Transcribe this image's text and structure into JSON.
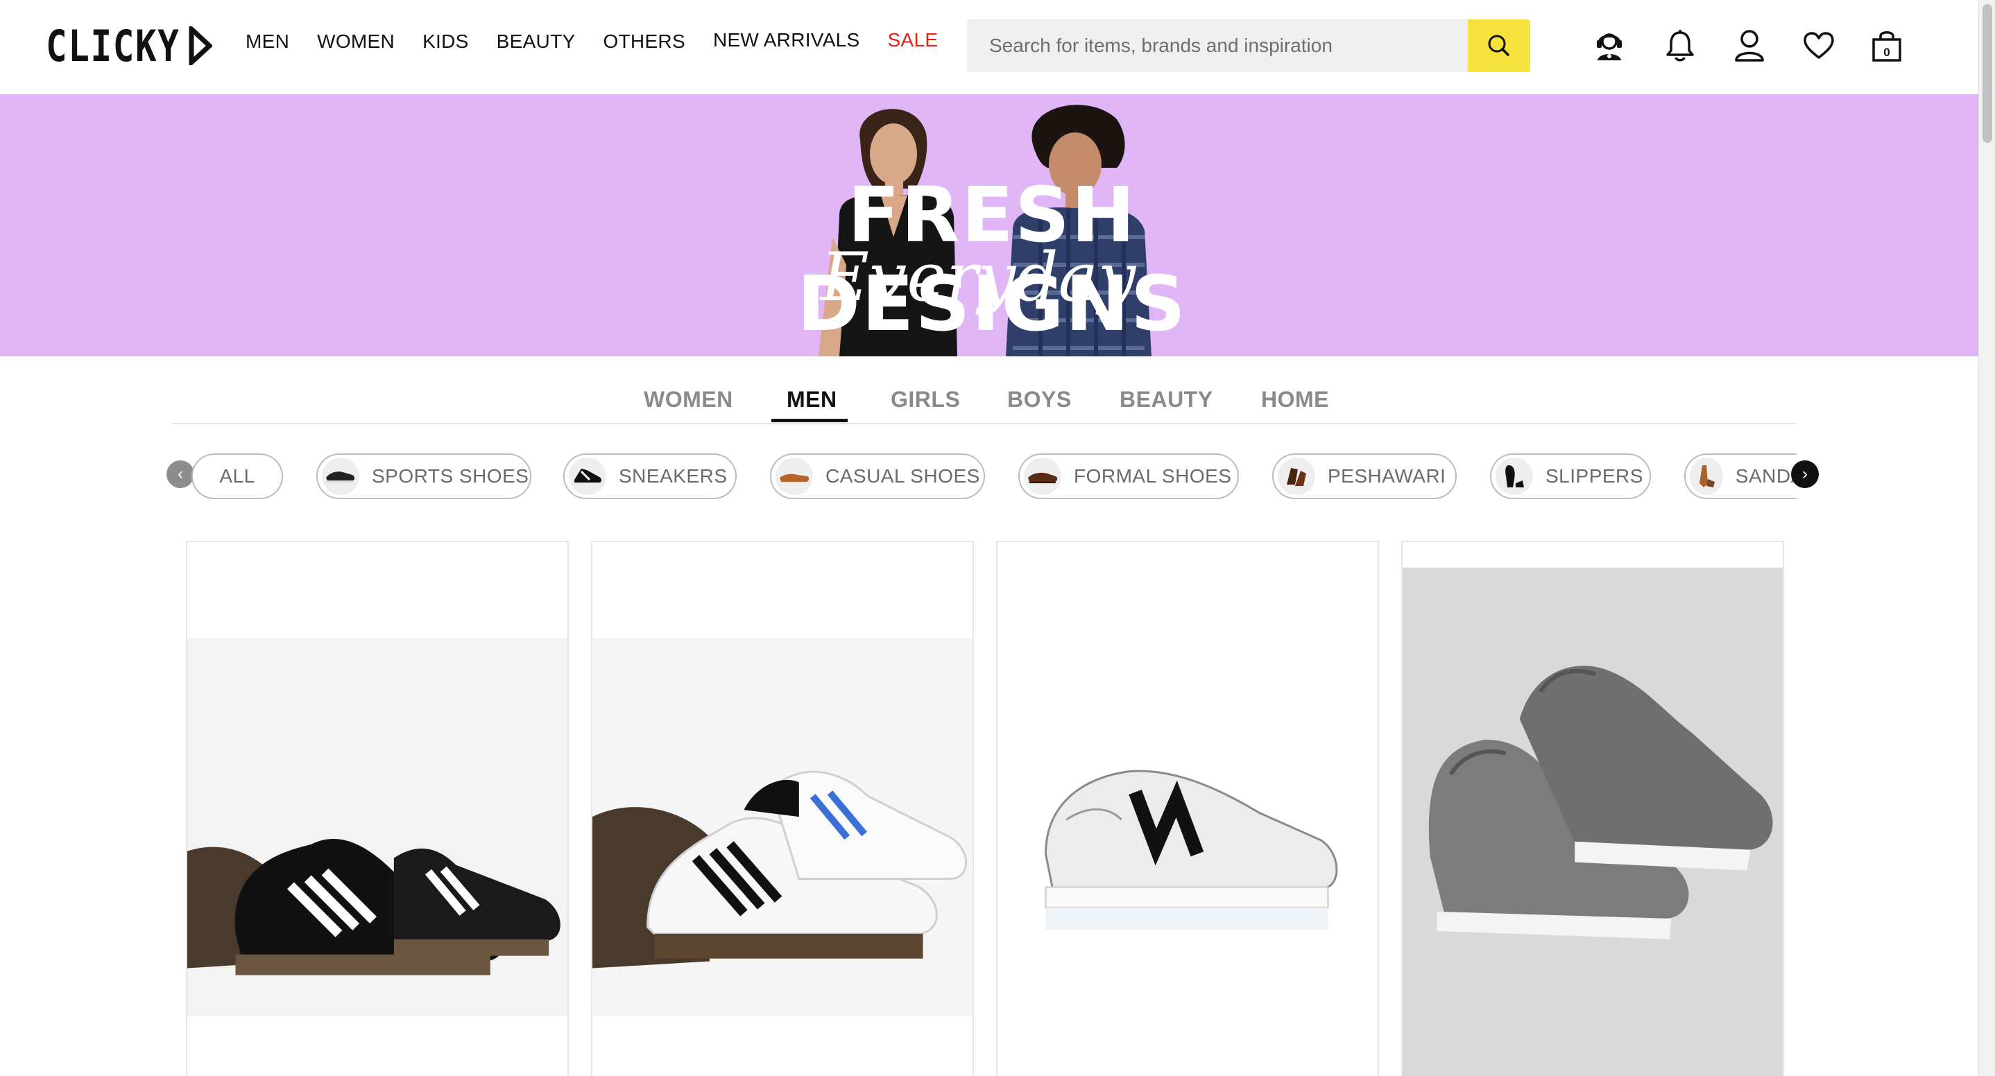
{
  "header": {
    "logo": "CLICKY",
    "nav": [
      {
        "label": "MEN"
      },
      {
        "label": "WOMEN"
      },
      {
        "label": "KIDS"
      },
      {
        "label": "BEAUTY"
      },
      {
        "label": "OTHERS"
      },
      {
        "label": "NEW ARRIVALS"
      },
      {
        "label": "SALE"
      }
    ],
    "search": {
      "placeholder": "Search for items, brands and inspiration",
      "value": ""
    },
    "icons": [
      "support-agent-icon",
      "bell-icon",
      "user-icon",
      "heart-icon",
      "shopping-bag-icon"
    ],
    "cart_count": "0"
  },
  "banner": {
    "title": "FRESH DESIGNS",
    "subtitle": "Everyday"
  },
  "tabs": {
    "items": [
      {
        "label": "WOMEN"
      },
      {
        "label": "MEN"
      },
      {
        "label": "GIRLS"
      },
      {
        "label": "BOYS"
      },
      {
        "label": "BEAUTY"
      },
      {
        "label": "HOME"
      }
    ],
    "active": "MEN"
  },
  "categories": [
    {
      "label": "ALL",
      "icon": ""
    },
    {
      "label": "SPORTS SHOES",
      "icon": "sports-shoe-icon"
    },
    {
      "label": "SNEAKERS",
      "icon": "sneaker-icon"
    },
    {
      "label": "CASUAL SHOES",
      "icon": "casual-shoe-icon"
    },
    {
      "label": "FORMAL SHOES",
      "icon": "formal-shoe-icon"
    },
    {
      "label": "PESHAWARI",
      "icon": "peshawari-icon"
    },
    {
      "label": "SLIPPERS",
      "icon": "slipper-icon"
    },
    {
      "label": "SANDALS",
      "icon": "sandal-icon"
    }
  ],
  "products": [
    {
      "image": "black-white-stripe-sneakers"
    },
    {
      "image": "white-black-stripe-sneakers"
    },
    {
      "image": "white-court-sneaker"
    },
    {
      "image": "grey-slip-on-sneakers"
    }
  ],
  "colors": {
    "accent_yellow": "#f5e23c",
    "sale_red": "#e2231a",
    "banner_bg": "#e1b6f7"
  }
}
